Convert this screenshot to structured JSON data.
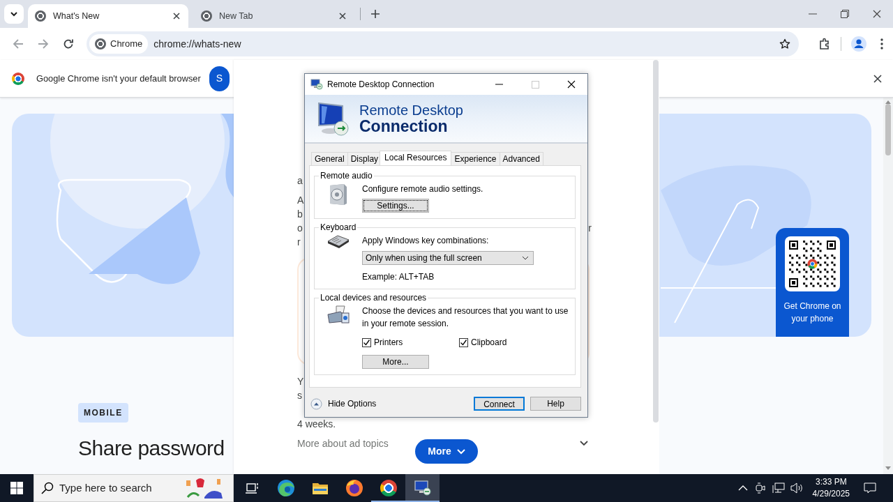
{
  "browser": {
    "tabs": [
      {
        "title": "What's New",
        "selected": true
      },
      {
        "title": "New Tab",
        "selected": false
      }
    ],
    "omnibox": {
      "chip": "Chrome",
      "url": "chrome://whats-new"
    }
  },
  "infobar": {
    "message": "Google Chrome isn't your default browser",
    "button": "S"
  },
  "page": {
    "qr_caption": "Get Chrome on your phone",
    "badge": "MOBILE",
    "heading": "Share password"
  },
  "panel": {
    "paragraphs": [
      {
        "lines": [
          {
            "start": "a"
          }
        ]
      },
      {
        "lines": [
          {
            "start": "A"
          },
          {
            "start": "b"
          },
          {
            "start": "o",
            "end": "r"
          },
          {
            "start": "r"
          }
        ]
      },
      {
        "lines": [
          {
            "start": "Y"
          },
          {
            "start": "s"
          }
        ]
      }
    ],
    "footnote": "4 weeks.",
    "expander": "More about ad topics",
    "more_button": "More"
  },
  "dialog": {
    "title": "Remote Desktop Connection",
    "banner": [
      "Remote Desktop",
      "Connection"
    ],
    "tabs": [
      {
        "label": "General",
        "selected": false
      },
      {
        "label": "Display",
        "selected": false
      },
      {
        "label": "Local Resources",
        "selected": true
      },
      {
        "label": "Experience",
        "selected": false
      },
      {
        "label": "Advanced",
        "selected": false
      }
    ],
    "groups": [
      {
        "kind": "audio",
        "title": "Remote audio",
        "description": "Configure remote audio settings.",
        "button": "Settings...",
        "button_focused": true
      },
      {
        "kind": "keyboard",
        "title": "Keyboard",
        "label": "Apply Windows key combinations:",
        "select": "Only when using the full screen",
        "example": "Example: ALT+TAB"
      },
      {
        "kind": "devices",
        "title": "Local devices and resources",
        "description": "Choose the devices and resources that you want to use in your remote session.",
        "checkboxes": [
          {
            "label": "Printers",
            "checked": true
          },
          {
            "label": "Clipboard",
            "checked": true
          }
        ],
        "button": "More...",
        "button_focused": false
      }
    ],
    "options_toggle": "Hide Options",
    "buttons": [
      {
        "label": "Connect",
        "default": true
      },
      {
        "label": "Help",
        "default": false
      }
    ]
  },
  "taskbar": {
    "search_placeholder": "Type here to search",
    "apps": [
      {
        "kind": "taskview",
        "running": false,
        "focused": false
      },
      {
        "kind": "edge",
        "running": false,
        "focused": false
      },
      {
        "kind": "explorer",
        "running": false,
        "focused": false
      },
      {
        "kind": "firefox",
        "running": false,
        "focused": false
      },
      {
        "kind": "chrome",
        "running": true,
        "focused": false
      },
      {
        "kind": "rdp",
        "running": true,
        "focused": true
      }
    ],
    "time": "3:33 PM",
    "date": "4/29/2025"
  }
}
